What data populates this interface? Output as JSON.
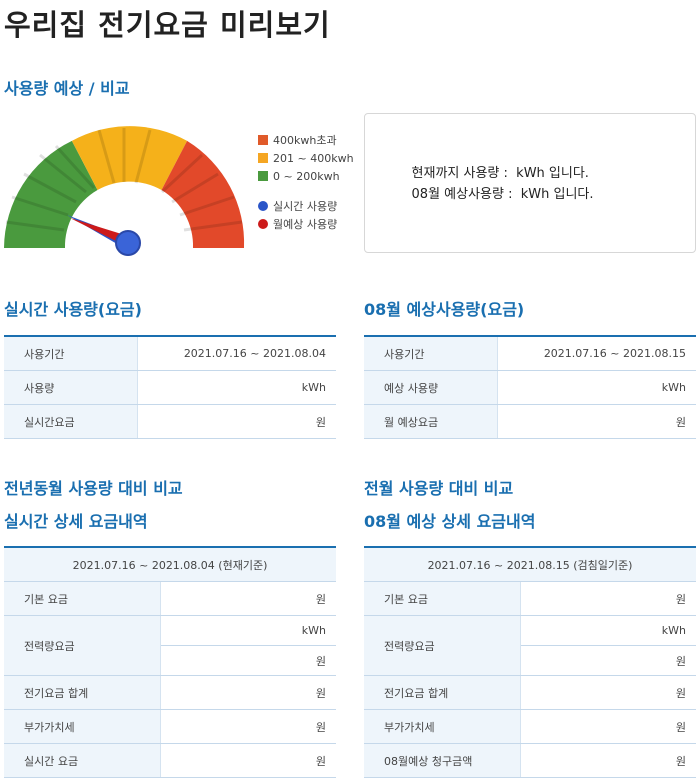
{
  "page_title": "우리집 전기요금 미리보기",
  "section_usage": "사용량 예상 / 비교",
  "legend": [
    {
      "label": "400kwh초과",
      "color": "#e05a2a",
      "shape": "square"
    },
    {
      "label": "201 ~ 400kwh",
      "color": "#f5a623",
      "shape": "square"
    },
    {
      "label": "0 ~ 200kwh",
      "color": "#4a9a3e",
      "shape": "square"
    },
    {
      "label": "실시간 사용량",
      "color": "#2a55c8",
      "shape": "dot"
    },
    {
      "label": "월예상 사용량",
      "color": "#cc1a1a",
      "shape": "dot"
    }
  ],
  "info": {
    "current_label": "현재까지 사용량 :",
    "current_unit": "kWh 입니다.",
    "forecast_label": "08월 예상사용량 :",
    "forecast_unit": "kWh 입니다."
  },
  "realtime": {
    "title": "실시간 사용량(요금)",
    "rows": [
      {
        "label": "사용기간",
        "value": "2021.07.16 ~ 2021.08.04"
      },
      {
        "label": "사용량",
        "value": "kWh"
      },
      {
        "label": "실시간요금",
        "value": "원"
      }
    ]
  },
  "forecast": {
    "title": "08월 예상사용량(요금)",
    "rows": [
      {
        "label": "사용기간",
        "value": "2021.07.16 ~ 2021.08.15"
      },
      {
        "label": "예상 사용량",
        "value": "kWh"
      },
      {
        "label": "월 예상요금",
        "value": "원"
      }
    ]
  },
  "compare_left": {
    "title1": "전년동월 사용량 대비 비교",
    "title2": "실시간 상세 요금내역",
    "period": "2021.07.16 ~ 2021.08.04 (현재기준)",
    "base": "기본 요금",
    "base_val": "원",
    "energy": "전력량요금",
    "energy_kwh": "kWh",
    "energy_won": "원",
    "total": "전기요금 합계",
    "total_val": "원",
    "vat": "부가가치세",
    "vat_val": "원",
    "final": "실시간 요금",
    "final_val": "원"
  },
  "compare_right": {
    "title1": "전월 사용량 대비 비교",
    "title2": "08월 예상 상세 요금내역",
    "period": "2021.07.16 ~ 2021.08.15 (검침일기준)",
    "base": "기본 요금",
    "base_val": "원",
    "energy": "전력량요금",
    "energy_kwh": "kWh",
    "energy_won": "원",
    "total": "전기요금 합계",
    "total_val": "원",
    "vat": "부가가치세",
    "vat_val": "원",
    "final": "08월예상 청구금액",
    "final_val": "원"
  }
}
